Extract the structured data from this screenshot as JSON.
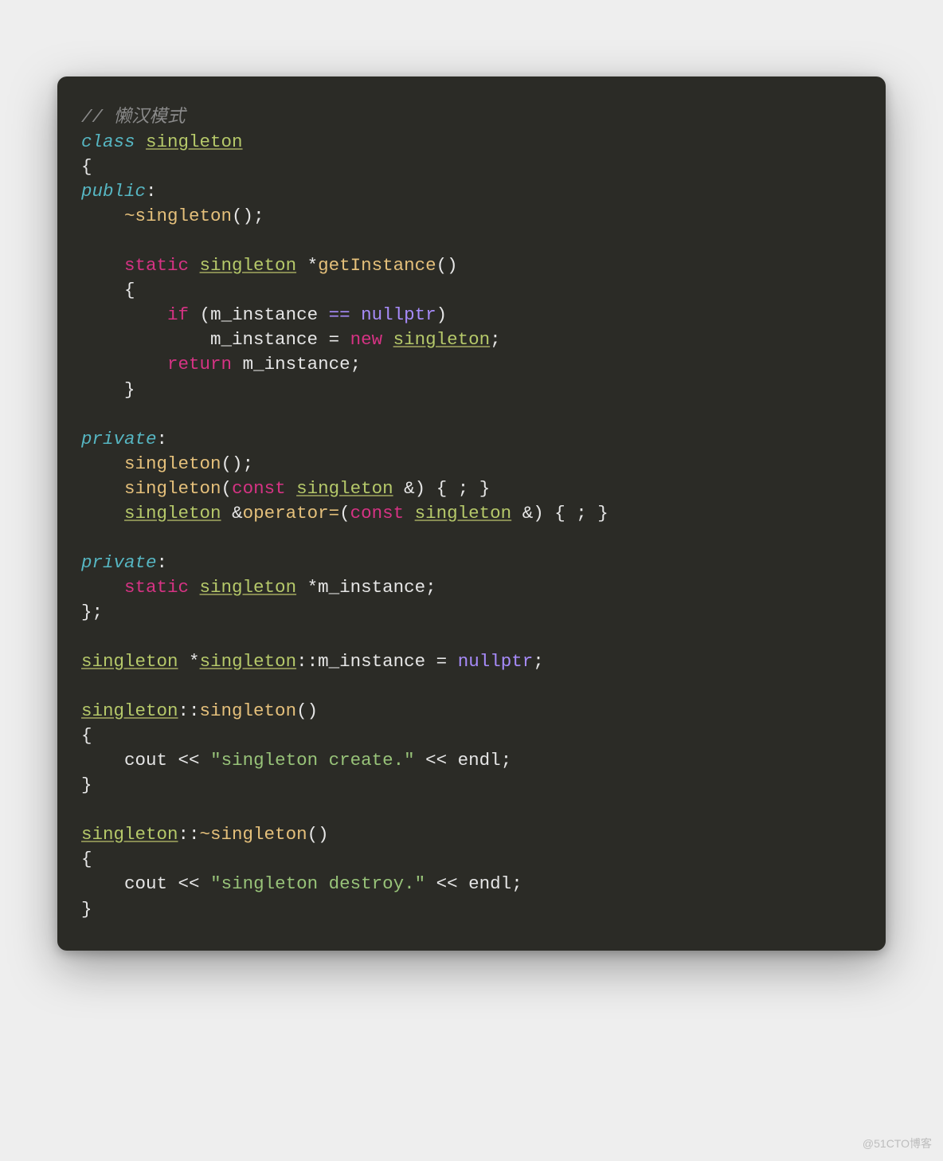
{
  "watermark": "@51CTO博客",
  "tokens": {
    "comment": "// 懒汉模式",
    "class": "class",
    "singleton": "singleton",
    "public": "public",
    "private": "private",
    "destructor": "~singleton",
    "static": "static",
    "getInstance": "getInstance",
    "if": "if",
    "m_instance": "m_instance",
    "eqeq": "==",
    "nullptr": "nullptr",
    "eq": "=",
    "new": "new",
    "return": "return",
    "const": "const",
    "operator": "operator=",
    "scope": "::",
    "str_create": "\"singleton create.\"",
    "str_destroy": "\"singleton destroy.\"",
    "cout": "cout",
    "endl": "endl",
    "ltlt": "<<",
    "star": "*",
    "amp": "&",
    "lbrace": "{",
    "rbrace": "}",
    "lparen": "(",
    "rparen": ")",
    "semi": ";",
    "colon": ":",
    "tilde": "~",
    "lbrace_semi_rbrace": "{ ; }",
    "rbrace_semi": "};",
    "open_call": "()",
    "m_instance_eq_nullptr_semi": "m_instance = nullptr;"
  }
}
